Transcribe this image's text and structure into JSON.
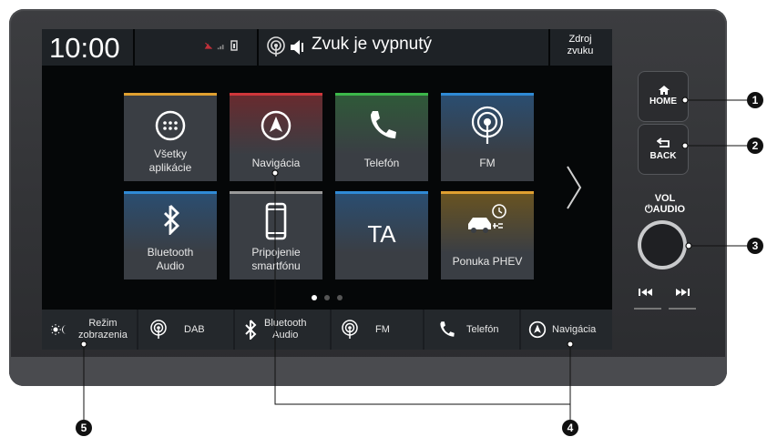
{
  "screen": {
    "clock": "10:00",
    "audio_status": "Zvuk je vypnutý",
    "source_button": {
      "line1": "Zdroj",
      "line2": "zvuku"
    }
  },
  "tiles": [
    {
      "line1": "Všetky",
      "line2": "aplikácie",
      "color": "#e0a030",
      "icon": "apps-grid-icon"
    },
    {
      "line1": "Navigácia",
      "line2": "",
      "color": "#d0363a",
      "icon": "navigation-icon"
    },
    {
      "line1": "Telefón",
      "line2": "",
      "color": "#3cb84a",
      "icon": "phone-icon"
    },
    {
      "line1": "FM",
      "line2": "",
      "color": "#2f8ad6",
      "icon": "radio-antenna-icon"
    },
    {
      "line1": "Bluetooth",
      "line2": "Audio",
      "color": "#2f8ad6",
      "icon": "bluetooth-icon"
    },
    {
      "line1": "Pripojenie",
      "line2": "smartfónu",
      "color": "#9a9a9a",
      "icon": "smartphone-icon"
    },
    {
      "line1": "TA",
      "line2": "",
      "color": "#2f8ad6",
      "icon": ""
    },
    {
      "line1": "Ponuka PHEV",
      "line2": "",
      "color": "#e0a030",
      "icon": "phev-car-icon"
    }
  ],
  "page_indicator": {
    "current": 1,
    "total": 3
  },
  "bottom_bar": [
    {
      "line1": "Režim",
      "line2": "zobrazenia",
      "icon": "display-mode-icon"
    },
    {
      "line1": "DAB",
      "line2": "",
      "icon": "radio-antenna-icon"
    },
    {
      "line1": "Bluetooth",
      "line2": "Audio",
      "icon": "bluetooth-icon"
    },
    {
      "line1": "FM",
      "line2": "",
      "icon": "radio-antenna-icon"
    },
    {
      "line1": "Telefón",
      "line2": "",
      "icon": "phone-icon"
    },
    {
      "line1": "Navigácia",
      "line2": "",
      "icon": "navigation-icon"
    }
  ],
  "hardware": {
    "home_label": "HOME",
    "back_label": "BACK",
    "vol_label_1": "VOL",
    "vol_label_2": "AUDIO"
  },
  "callouts": [
    "1",
    "2",
    "3",
    "4",
    "5"
  ]
}
